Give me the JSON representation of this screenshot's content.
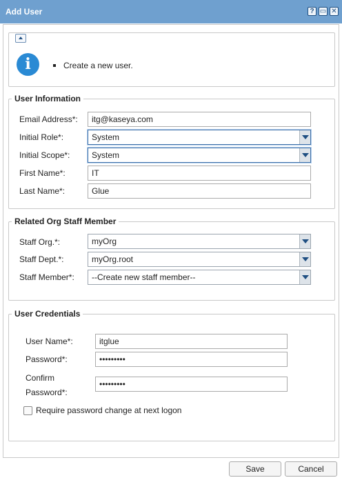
{
  "window": {
    "title": "Add User",
    "controls": [
      {
        "icon": "help-icon",
        "glyph": "?"
      },
      {
        "icon": "maximize-icon",
        "glyph": "▭"
      },
      {
        "icon": "close-icon",
        "glyph": "✕"
      }
    ]
  },
  "info": {
    "icon": "info-icon",
    "icon_glyph": "i",
    "message": "Create a new user."
  },
  "user_information": {
    "legend": "User Information",
    "email": {
      "label": "Email Address*:",
      "value": "itg@kaseya.com"
    },
    "role": {
      "label": "Initial Role*:",
      "value": "System"
    },
    "scope": {
      "label": "Initial Scope*:",
      "value": "System"
    },
    "first_name": {
      "label": "First Name*:",
      "value": "IT"
    },
    "last_name": {
      "label": "Last Name*:",
      "value": "Glue"
    }
  },
  "staff": {
    "legend": "Related Org Staff Member",
    "org": {
      "label": "Staff Org.*:",
      "value": "myOrg"
    },
    "dept": {
      "label": "Staff Dept.*:",
      "value": "myOrg.root"
    },
    "member": {
      "label": "Staff Member*:",
      "value": "--Create new staff member--"
    }
  },
  "credentials": {
    "legend": "User Credentials",
    "username": {
      "label": "User Name*:",
      "value": "itglue"
    },
    "password": {
      "label": "Password*:",
      "value": "•••••••••"
    },
    "confirm": {
      "label_line1": "Confirm",
      "label_line2": "Password*:",
      "value": "•••••••••"
    },
    "require_change": {
      "label": "Require password change at next logon",
      "checked": false
    }
  },
  "footer": {
    "save": "Save",
    "cancel": "Cancel"
  },
  "colors": {
    "titlebar": "#6fa0cf",
    "info_icon": "#2a8ad4",
    "dropdown_arrow": "#1f4f82"
  }
}
